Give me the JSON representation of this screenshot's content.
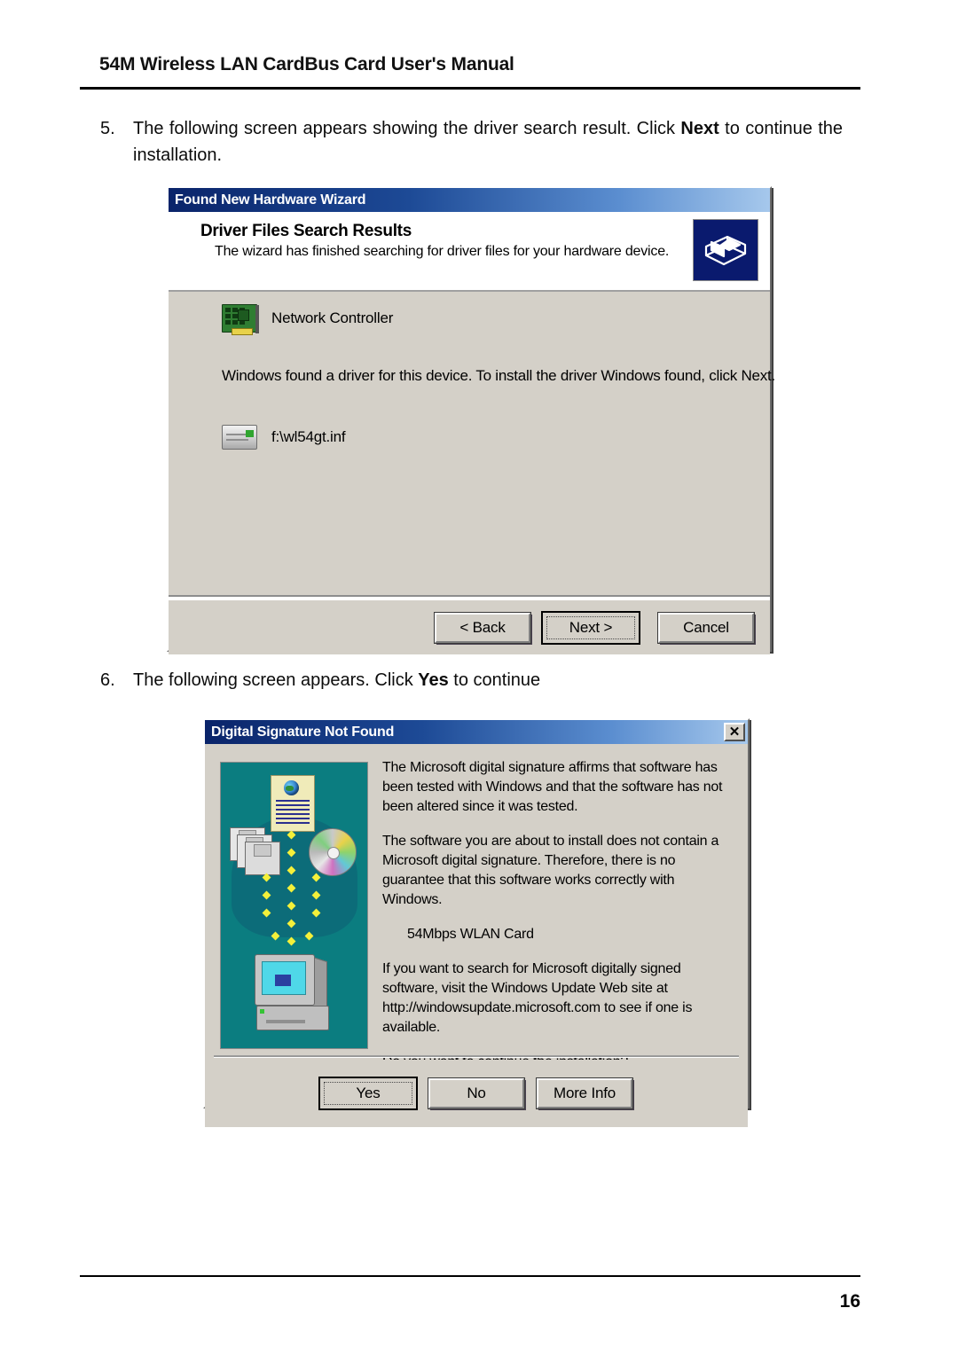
{
  "document": {
    "header_title": "54M Wireless LAN CardBus Card User's Manual",
    "page_number": "16"
  },
  "steps": [
    {
      "number": "5.",
      "text_before_bold": "The following screen appears showing the driver search result. Click ",
      "bold": "Next",
      "text_after_bold": " to continue the installation."
    },
    {
      "number": "6.",
      "text_before_bold": "The following screen appears. Click ",
      "bold": "Yes",
      "text_after_bold": " to continue"
    }
  ],
  "wizard_dialog": {
    "title": "Found New Hardware Wizard",
    "heading": "Driver Files Search Results",
    "subheading": "The wizard has finished searching for driver files for your hardware device.",
    "device_name": "Network Controller",
    "note": "Windows found a driver for this device. To install the driver Windows found, click Next.",
    "inf_file": "f:\\wl54gt.inf",
    "buttons": {
      "back": "< Back",
      "next": "Next >",
      "cancel": "Cancel"
    },
    "icons": {
      "device": "network-card-icon",
      "file": "inf-file-icon",
      "banner": "wizard-hardware-icon"
    }
  },
  "signature_dialog": {
    "title": "Digital Signature Not Found",
    "close_label": "✕",
    "paragraphs": [
      "The Microsoft digital signature affirms that software has been tested with Windows and that the software has not been altered since it was tested.",
      "The software you are about to install does not contain a Microsoft digital signature. Therefore,  there is no guarantee that this software works correctly with Windows.",
      "54Mbps WLAN Card",
      "If you want to search for Microsoft digitally signed software, visit the Windows Update Web site at http://windowsupdate.microsoft.com to see if one is available.",
      "Do you want to continue the installation?"
    ],
    "buttons": {
      "yes": "Yes",
      "no": "No",
      "more_info": "More Info"
    },
    "illustration_name": "digital-signature-illustration"
  },
  "colors": {
    "titlebar_start": "#0a246a",
    "titlebar_end": "#a6c8ec",
    "dialog_face": "#d4d0c8",
    "art_background": "#0b7d80",
    "banner_icon_bg": "#0a1a6e"
  }
}
